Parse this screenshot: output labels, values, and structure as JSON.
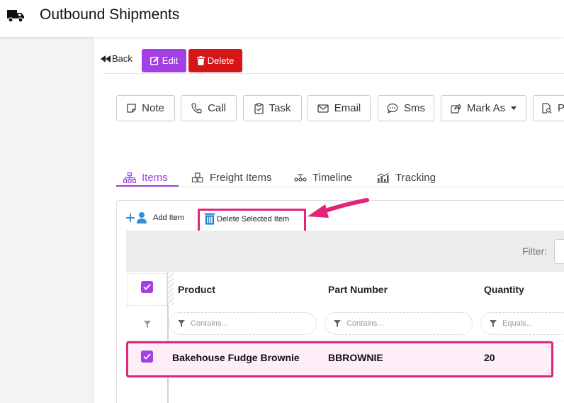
{
  "header": {
    "title": "Outbound Shipments",
    "icon": "truck-icon"
  },
  "actions": {
    "back_label": "Back",
    "edit_label": "Edit",
    "delete_label": "Delete"
  },
  "activity_buttons": [
    {
      "label": "Note",
      "icon": "note-icon"
    },
    {
      "label": "Call",
      "icon": "phone-icon"
    },
    {
      "label": "Task",
      "icon": "clipboard-icon"
    },
    {
      "label": "Email",
      "icon": "envelope-icon"
    },
    {
      "label": "Sms",
      "icon": "sms-icon"
    },
    {
      "label": "Mark As",
      "icon": "share-icon"
    },
    {
      "label": "P",
      "icon": "document-search-icon"
    }
  ],
  "tabs": [
    {
      "label": "Items",
      "icon": "sitemap-icon",
      "active": true
    },
    {
      "label": "Freight Items",
      "icon": "cubes-icon",
      "active": false
    },
    {
      "label": "Timeline",
      "icon": "timeline-icon",
      "active": false
    },
    {
      "label": "Tracking",
      "icon": "chart-icon",
      "active": false
    }
  ],
  "grid": {
    "toolbar": {
      "add_item": "Add Item",
      "delete_selected": "Delete Selected Item"
    },
    "filter_label": "Filter:",
    "columns": [
      "Product",
      "Part Number",
      "Quantity"
    ],
    "filter_placeholders": [
      "Contains...",
      "Contains...",
      "Equals..."
    ],
    "rows": [
      {
        "product": "Bakehouse Fudge Brownie",
        "part_number": "BBROWNIE",
        "quantity": "20",
        "selected": true
      }
    ]
  },
  "colors": {
    "accent": "#a43fe6",
    "danger": "#d51616",
    "highlight": "#e3247b",
    "selected_row": "#fdeefa"
  }
}
